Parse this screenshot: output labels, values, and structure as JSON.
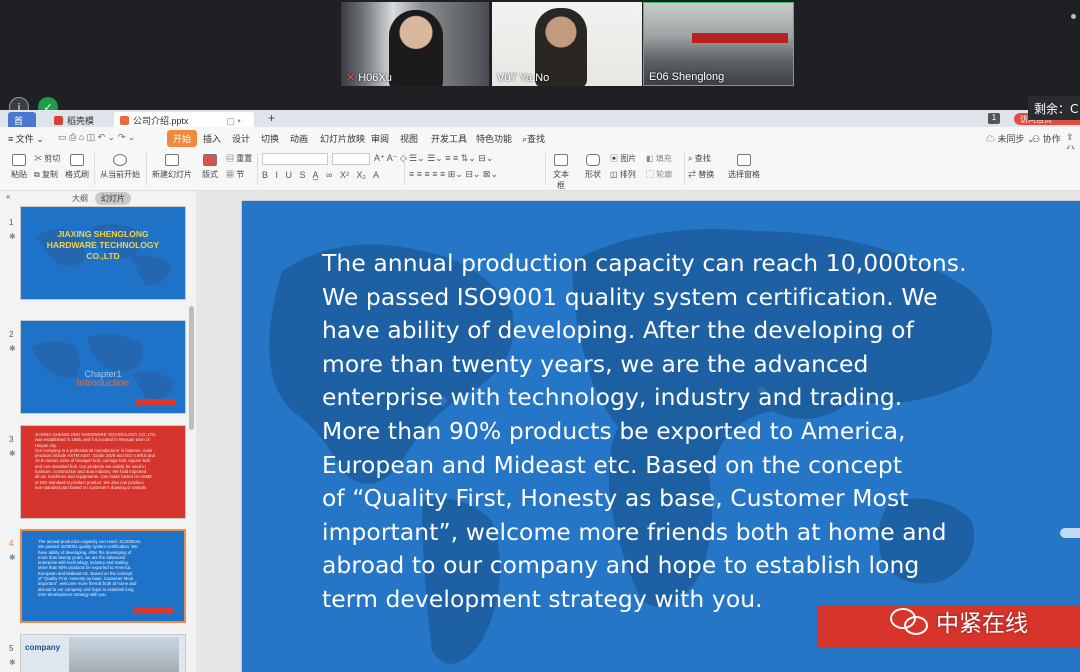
{
  "meeting": {
    "participants": [
      {
        "name": "H06Xu",
        "muted": true
      },
      {
        "name": "V07 Ya No",
        "muted": false
      },
      {
        "name": "E06 Shenglong",
        "muted": false
      }
    ],
    "remaining_label": "剩余：",
    "remaining_value": "C"
  },
  "tabs": {
    "home": "首页",
    "template": "稻壳模板",
    "file": "公司介绍.pptx",
    "add": "+",
    "right_badge": "1",
    "right_button": "访问首页"
  },
  "menu": {
    "file": "文件",
    "items": [
      "开始",
      "插入",
      "设计",
      "切换",
      "动画",
      "幻灯片放映",
      "审阅",
      "视图",
      "开发工具",
      "特色功能"
    ],
    "search": "查找",
    "sync": "未同步",
    "collab": "协作",
    "share": "分"
  },
  "ribbon": {
    "paste": "粘贴",
    "cut": "剪切",
    "copy": "复制",
    "format_painter": "格式刷",
    "from_current": "从当前开始",
    "new_slide": "新建幻灯片",
    "layout": "版式",
    "reset": "重置",
    "section": "节",
    "textbox": "文本框",
    "shape": "形状",
    "picture": "图片",
    "arrange": "排列",
    "fill": "填充",
    "outline": "轮廓",
    "find": "查找",
    "replace": "替换",
    "select_pane": "选择窗格"
  },
  "pane": {
    "outline_tab": "大纲",
    "slides_tab": "幻灯片",
    "slide_numbers": [
      "1",
      "2",
      "3",
      "4",
      "5"
    ],
    "t1_title": "JIAXING SHENGLONG\nHARDWARE TECHNOLOGY\nCO.,LTD",
    "t2_chapter": "Chapter1",
    "t2_intro": "Introduction",
    "t3_text": "JIAXING SHENGLONG HARDWARE TECHNOLOGY CO.,LTD.\nwas established in 1995, and it is located in Wuyuan town of\nHaiyan city.\nOur company is a professional manufacturer in fastener, main\nproducts include ASTM A307, Grade 2/5/8 and ISO 4.8/8.8 and\n10.9 various sizes of hexagon bolt, carriage bolt, square bolt\nand non-standard bolt. Our products are widely be used in\nfurniture, construction and auto industry. We hold imported\nall our machines and equipments. Can make based on ASME\nor DIN standard to product product. We also can produce\nnon-standard part based on customer's drawing or sample.",
    "t4_text": "The annual production capacity can reach 10,000tons.\nWe passed ISO9001 quality system certification. We\nhave ability of developing. After the developing of\nmore than twenty years, we are the advanced\nenterprise with technology, industry and trading.\nMore than 90% products be exported to America,\nEuropean and Mideast etc. Based on the concept\nof “Quality First, Honesty as base, Customer Most\nimportant”, welcome more friends both at home and\nabroad to our company and hope to establish long\nterm development strategy with you.",
    "t5_title": "company"
  },
  "slide": {
    "body": "The annual production capacity can reach 10,000tons.\nWe passed ISO9001 quality system certification. We\nhave ability of developing. After the developing of\nmore than twenty years, we are the advanced\nenterprise with technology, industry and trading.\nMore than 90% products be exported to America,\nEuropean and Mideast etc. Based on the concept\nof “Quality First, Honesty as base, Customer Most\nimportant”, welcome more friends both at home and\nabroad to our company and hope to establish long\nterm development strategy with you.",
    "background_color": "#2576c6",
    "accent_red": "#d7342b"
  },
  "watermark": {
    "text": "中紧在线",
    "icon": "wechat-logo-icon"
  }
}
